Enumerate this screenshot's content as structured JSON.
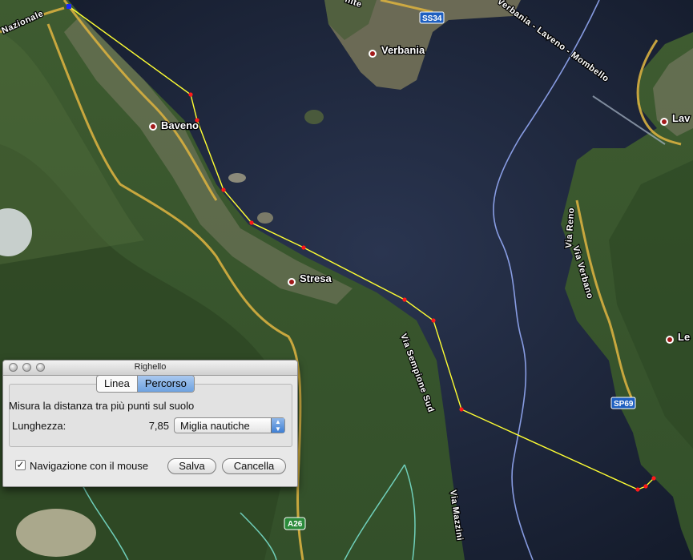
{
  "map": {
    "places": [
      {
        "name": "Baveno"
      },
      {
        "name": "Verbania"
      },
      {
        "name": "Stresa"
      },
      {
        "name": "Lav"
      },
      {
        "name": "Le"
      }
    ],
    "roads": {
      "nazionale": "Nazionale",
      "nite": "nite",
      "verbania_laveno": "Verbania - Laveno - Mombello",
      "sempione": "Via Sempione Sud",
      "mazzini": "Via Mazzini",
      "reno": "Via Reno",
      "verbano": "Via Verbano"
    },
    "shields": {
      "ss34": "SS34",
      "sp69": "SP69",
      "a26": "A26"
    },
    "colors": {
      "measure_line": "#ffff33",
      "measure_point": "#ff1a1a",
      "road": "#d8b040",
      "border": "#9ab0ff"
    }
  },
  "ruler": {
    "title": "Righello",
    "tabs": [
      "Linea",
      "Percorso"
    ],
    "selected_tab": "Percorso",
    "description": "Misura la distanza tra più punti sul suolo",
    "length_label": "Lunghezza:",
    "length_value": "7,85",
    "unit": "Miglia nautiche",
    "mouse_nav_label": "Navigazione con il mouse",
    "mouse_nav_checked": true,
    "save_label": "Salva",
    "cancel_label": "Cancella"
  }
}
